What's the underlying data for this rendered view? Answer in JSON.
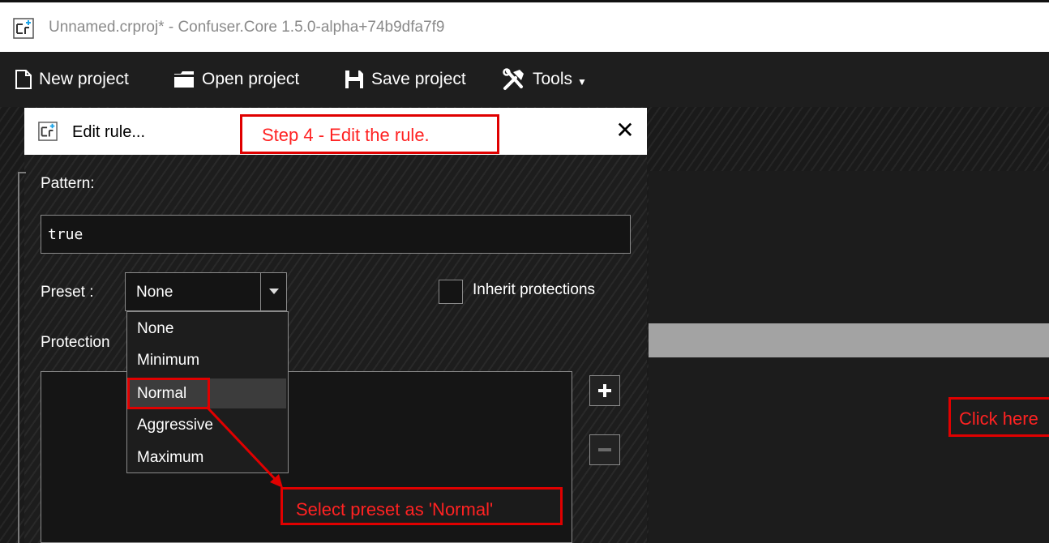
{
  "window": {
    "title": "Unnamed.crproj* - Confuser.Core 1.5.0-alpha+74b9dfa7f9",
    "icon": "confuser-app-icon"
  },
  "toolbar": {
    "new_project": "New project",
    "open_project": "Open project",
    "save_project": "Save project",
    "tools": "Tools"
  },
  "dialog": {
    "title": "Edit rule...",
    "pattern_label": "Pattern:",
    "pattern_value": "true",
    "preset_label": "Preset :",
    "preset_value": "None",
    "inherit_label": "Inherit protections",
    "inherit_checked": false,
    "protections_label": "Protection",
    "preset_options": [
      "None",
      "Minimum",
      "Normal",
      "Aggressive",
      "Maximum"
    ],
    "hovered_option": "Normal"
  },
  "annotations": {
    "step4": "Step 4 - Edit the rule.",
    "select_preset": "Select preset as 'Normal'",
    "click_here": "Click here"
  },
  "colors": {
    "background": "#1e1e1e",
    "annotation": "#e00000",
    "titlebar": "#ffffff"
  }
}
